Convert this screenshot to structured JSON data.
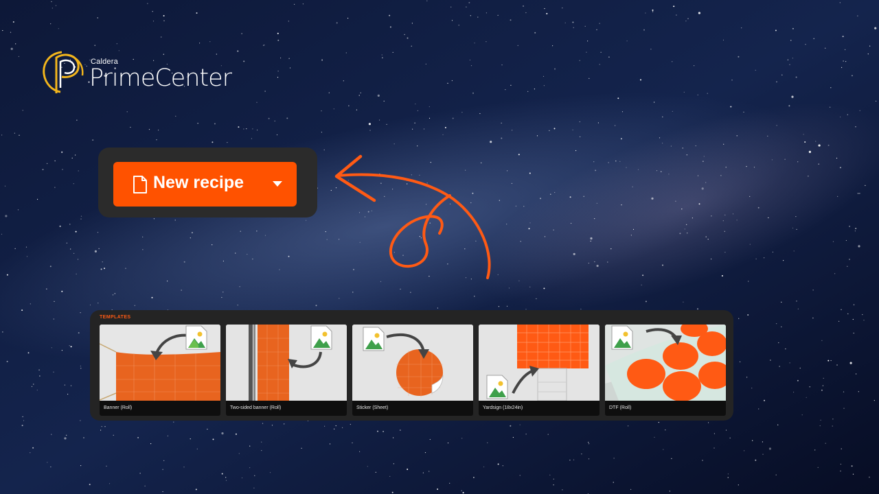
{
  "logo": {
    "brand_small": "Caldera",
    "product": "PrimeCenter"
  },
  "new_recipe": {
    "label": "New recipe"
  },
  "templates": {
    "title": "TEMPLATES",
    "items": [
      {
        "caption": "Banner (Roll)"
      },
      {
        "caption": "Two-sided banner (Roll)"
      },
      {
        "caption": "Sticker (Sheet)"
      },
      {
        "caption": "Yardsign (18x24in)"
      },
      {
        "caption": "DTF (Roll)"
      }
    ]
  },
  "colors": {
    "accent": "#ff5200",
    "panel": "#2b2b2b",
    "background": "#0b1330",
    "logo_gold": "#f2b51c"
  }
}
